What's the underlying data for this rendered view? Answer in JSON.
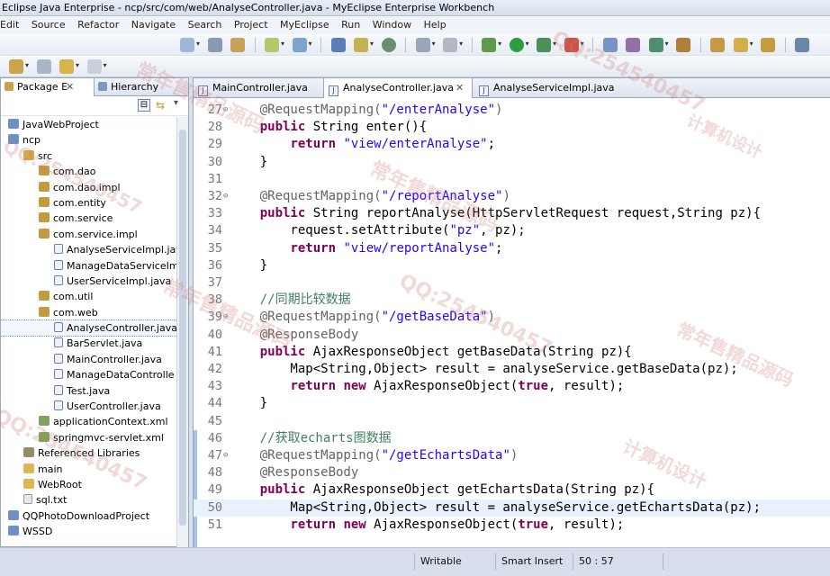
{
  "window": {
    "title": "Eclipse Java Enterprise - ncp/src/com/web/AnalyseController.java - MyEclipse Enterprise Workbench"
  },
  "menu": [
    "Edit",
    "Source",
    "Refactor",
    "Navigate",
    "Search",
    "Project",
    "MyEclipse",
    "Run",
    "Window",
    "Help"
  ],
  "left_panel": {
    "tabs": [
      {
        "label": "Package E",
        "active": true
      },
      {
        "label": "Hierarchy",
        "active": false
      }
    ],
    "tree": [
      {
        "label": "JavaWebProject",
        "icon": "project-icon",
        "depth": 0
      },
      {
        "label": "ncp",
        "icon": "project-icon",
        "depth": 0
      },
      {
        "label": "src",
        "icon": "source-folder-icon",
        "depth": 1
      },
      {
        "label": "com.dao",
        "icon": "package-icon",
        "depth": 2
      },
      {
        "label": "com.dao.impl",
        "icon": "package-icon",
        "depth": 2
      },
      {
        "label": "com.entity",
        "icon": "package-icon",
        "depth": 2
      },
      {
        "label": "com.service",
        "icon": "package-icon",
        "depth": 2
      },
      {
        "label": "com.service.impl",
        "icon": "package-icon",
        "depth": 2
      },
      {
        "label": "AnalyseServiceImpl.java",
        "icon": "java-file-icon",
        "depth": 3
      },
      {
        "label": "ManageDataServiceIm",
        "icon": "java-file-icon",
        "depth": 3
      },
      {
        "label": "UserServiceImpl.java",
        "icon": "java-file-icon",
        "depth": 3
      },
      {
        "label": "com.util",
        "icon": "package-icon",
        "depth": 2
      },
      {
        "label": "com.web",
        "icon": "package-icon",
        "depth": 2
      },
      {
        "label": "AnalyseController.java",
        "icon": "java-file-icon",
        "depth": 3,
        "selected": true
      },
      {
        "label": "BarServlet.java",
        "icon": "java-file-icon",
        "depth": 3
      },
      {
        "label": "MainController.java",
        "icon": "java-file-icon",
        "depth": 3
      },
      {
        "label": "ManageDataControlle",
        "icon": "java-file-icon",
        "depth": 3
      },
      {
        "label": "Test.java",
        "icon": "java-file-icon",
        "depth": 3
      },
      {
        "label": "UserController.java",
        "icon": "java-file-icon",
        "depth": 3
      },
      {
        "label": "applicationContext.xml",
        "icon": "xml-file-icon",
        "depth": 2
      },
      {
        "label": "springmvc-servlet.xml",
        "icon": "xml-file-icon",
        "depth": 2
      },
      {
        "label": "Referenced Libraries",
        "icon": "library-icon",
        "depth": 1
      },
      {
        "label": "main",
        "icon": "folder-icon",
        "depth": 1
      },
      {
        "label": "WebRoot",
        "icon": "folder-icon",
        "depth": 1
      },
      {
        "label": "sql.txt",
        "icon": "text-file-icon",
        "depth": 1
      },
      {
        "label": "QQPhotoDownloadProject",
        "icon": "project-icon",
        "depth": 0
      },
      {
        "label": "WSSD",
        "icon": "project-icon",
        "depth": 0
      }
    ]
  },
  "editor": {
    "tabs": [
      {
        "label": "MainController.java",
        "active": false
      },
      {
        "label": "AnalyseController.java",
        "active": true
      },
      {
        "label": "AnalyseServiceImpl.java",
        "active": false
      }
    ],
    "lines": [
      {
        "n": "27",
        "fold": "⊖",
        "segs": [
          [
            "ann",
            "    @RequestMapping("
          ],
          [
            "str",
            "\"/enterAnalyse\""
          ],
          [
            "ann",
            ")"
          ]
        ]
      },
      {
        "n": "28",
        "segs": [
          [
            "",
            "    "
          ],
          [
            "kw",
            "public"
          ],
          [
            "",
            " String enter(){"
          ]
        ]
      },
      {
        "n": "29",
        "segs": [
          [
            "",
            "        "
          ],
          [
            "kw",
            "return"
          ],
          [
            "",
            " "
          ],
          [
            "str",
            "\"view/enterAnalyse\""
          ],
          [
            "",
            ";"
          ]
        ]
      },
      {
        "n": "30",
        "segs": [
          [
            "",
            "    }"
          ]
        ]
      },
      {
        "n": "31",
        "segs": [
          [
            "",
            ""
          ]
        ]
      },
      {
        "n": "32",
        "fold": "⊖",
        "segs": [
          [
            "ann",
            "    @RequestMapping("
          ],
          [
            "str",
            "\"/reportAnalyse\""
          ],
          [
            "ann",
            ")"
          ]
        ]
      },
      {
        "n": "33",
        "segs": [
          [
            "",
            "    "
          ],
          [
            "kw",
            "public"
          ],
          [
            "",
            " String reportAnalyse(HttpServletRequest request,String pz){"
          ]
        ]
      },
      {
        "n": "34",
        "segs": [
          [
            "",
            "        request.setAttribute("
          ],
          [
            "str",
            "\"pz\""
          ],
          [
            "",
            ", pz);"
          ]
        ]
      },
      {
        "n": "35",
        "segs": [
          [
            "",
            "        "
          ],
          [
            "kw",
            "return"
          ],
          [
            "",
            " "
          ],
          [
            "str",
            "\"view/reportAnalyse\""
          ],
          [
            "",
            ";"
          ]
        ]
      },
      {
        "n": "36",
        "segs": [
          [
            "",
            "    }"
          ]
        ]
      },
      {
        "n": "37",
        "segs": [
          [
            "",
            ""
          ]
        ]
      },
      {
        "n": "38",
        "segs": [
          [
            "cmt",
            "    //同期比较数据"
          ]
        ]
      },
      {
        "n": "39",
        "fold": "⊖",
        "segs": [
          [
            "ann",
            "    @RequestMapping("
          ],
          [
            "str",
            "\"/getBaseData\""
          ],
          [
            "ann",
            ")"
          ]
        ]
      },
      {
        "n": "40",
        "segs": [
          [
            "ann",
            "    @ResponseBody"
          ]
        ]
      },
      {
        "n": "41",
        "segs": [
          [
            "",
            "    "
          ],
          [
            "kw",
            "public"
          ],
          [
            "",
            " AjaxResponseObject getBaseData(String pz){"
          ]
        ]
      },
      {
        "n": "42",
        "segs": [
          [
            "",
            "        Map<String,Object> result = analyseService.getBaseData(pz);"
          ]
        ]
      },
      {
        "n": "43",
        "segs": [
          [
            "",
            "        "
          ],
          [
            "kw",
            "return"
          ],
          [
            "",
            " "
          ],
          [
            "kw",
            "new"
          ],
          [
            "",
            " AjaxResponseObject("
          ],
          [
            "kw",
            "true"
          ],
          [
            "",
            ", result);"
          ]
        ]
      },
      {
        "n": "44",
        "segs": [
          [
            "",
            "    }"
          ]
        ]
      },
      {
        "n": "45",
        "segs": [
          [
            "",
            ""
          ]
        ]
      },
      {
        "n": "46",
        "segs": [
          [
            "cmt",
            "    //获取echarts图数据"
          ]
        ]
      },
      {
        "n": "47",
        "fold": "⊖",
        "segs": [
          [
            "ann",
            "    @RequestMapping("
          ],
          [
            "str",
            "\"/getEchartsData\""
          ],
          [
            "ann",
            ")"
          ]
        ]
      },
      {
        "n": "48",
        "segs": [
          [
            "ann",
            "    @ResponseBody"
          ]
        ]
      },
      {
        "n": "49",
        "segs": [
          [
            "",
            "    "
          ],
          [
            "kw",
            "public"
          ],
          [
            "",
            " AjaxResponseObject getEchartsData(String pz){"
          ]
        ]
      },
      {
        "n": "50",
        "hl": true,
        "segs": [
          [
            "",
            "        Map<String,Object> result = analyseService.getEchartsData(pz);"
          ]
        ]
      },
      {
        "n": "51",
        "segs": [
          [
            "",
            "        "
          ],
          [
            "kw",
            "return"
          ],
          [
            "",
            " "
          ],
          [
            "kw",
            "new"
          ],
          [
            "",
            " AjaxResponseObject("
          ],
          [
            "kw",
            "true"
          ],
          [
            "",
            ", result);"
          ]
        ]
      }
    ]
  },
  "status": {
    "mode": "Writable",
    "insert": "Smart Insert",
    "position": "50 : 57"
  },
  "watermark": {
    "items": [
      "常年售精品源码",
      "QQ:254540457",
      "常年售精品源码",
      "QQ:254540457",
      "计算机设计",
      "常年售精品源码",
      "QQ:254540457",
      "常年售精品源码",
      "QQ:254540457",
      "计算机设计"
    ]
  },
  "colors": {
    "keyword": "#7f0055",
    "string": "#2a00ff",
    "comment": "#3f7f5f",
    "annotation": "#646464",
    "current_line": "#e8f2fe"
  }
}
